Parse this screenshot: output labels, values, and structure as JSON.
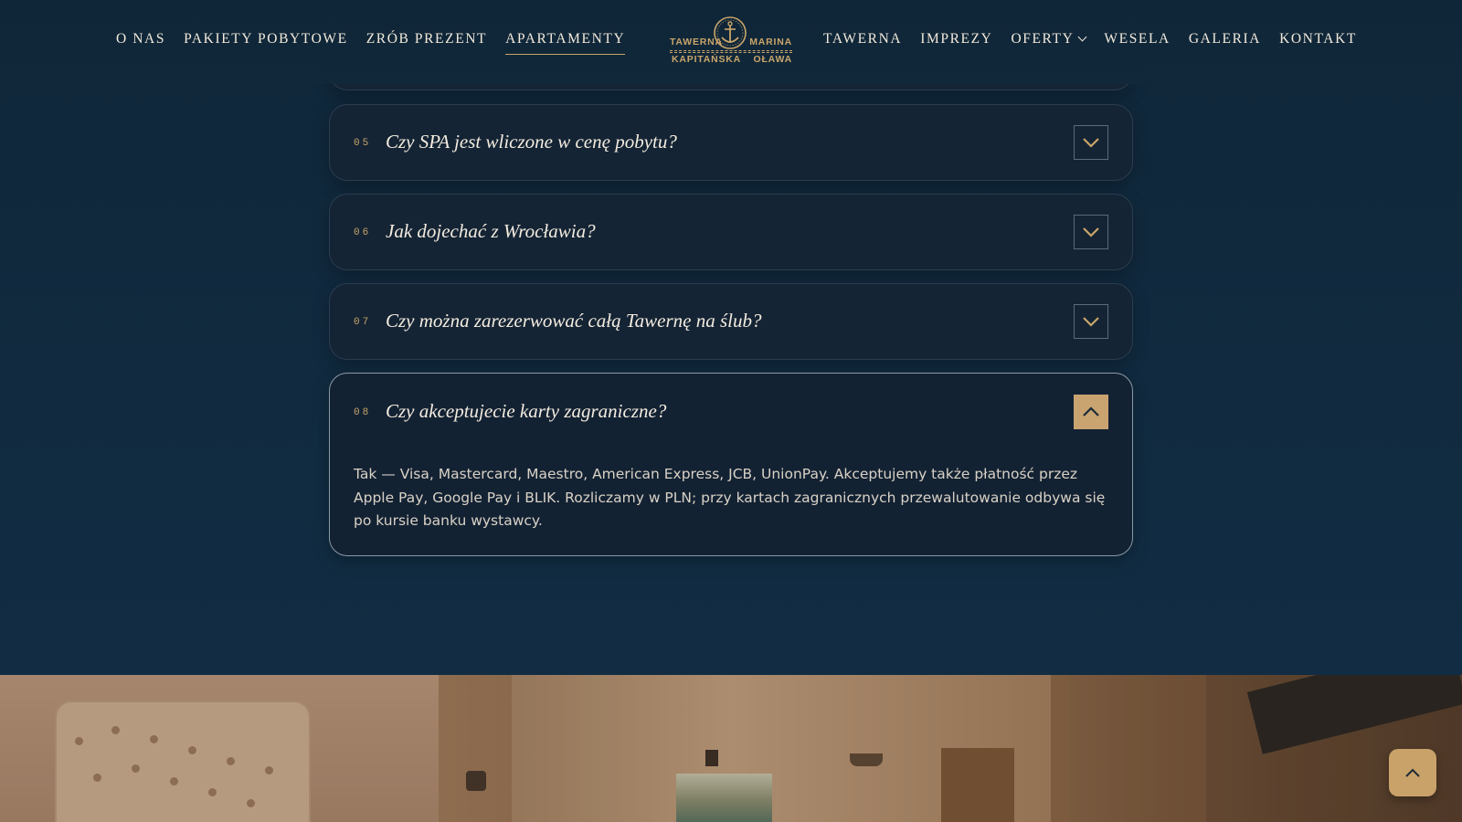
{
  "nav": {
    "left": [
      {
        "label": "O NAS"
      },
      {
        "label": "PAKIETY POBYTOWE"
      },
      {
        "label": "ZRÓB PREZENT"
      },
      {
        "label": "APARTAMENTY",
        "active": true
      }
    ],
    "right": [
      {
        "label": "TAWERNA"
      },
      {
        "label": "IMPREZY"
      },
      {
        "label": "OFERTY",
        "dropdown": true
      },
      {
        "label": "WESELA"
      },
      {
        "label": "GALERIA"
      },
      {
        "label": "KONTAKT"
      }
    ]
  },
  "logo": {
    "line1_left": "TAWERNA",
    "line1_right": "MARINA",
    "line2_left": "KAPITAŃSKA",
    "line2_right": "OŁAWA",
    "icon": "anchor-icon"
  },
  "faq": {
    "items": [
      {
        "num": "05",
        "question": "Czy SPA jest wliczone w cenę pobytu?",
        "open": false
      },
      {
        "num": "06",
        "question": "Jak dojechać z Wrocławia?",
        "open": false
      },
      {
        "num": "07",
        "question": "Czy można zarezerwować całą Tawernę na ślub?",
        "open": false
      },
      {
        "num": "08",
        "question": "Czy akceptujecie karty zagraniczne?",
        "open": true,
        "answer": "Tak — Visa, Mastercard, Maestro, American Express, JCB, UnionPay. Akceptujemy także płatność przez Apple Pay, Google Pay i BLIK. Rozliczamy w PLN; przy kartach zagranicznych przewalutowanie odbywa się po kursie banku wystawcy."
      }
    ]
  },
  "colors": {
    "background": "#10293d",
    "accent_gold": "#c9a56a",
    "card": "#142434",
    "text_light": "#f4ece0"
  },
  "icons": {
    "toggle_closed": "chevron-down-icon",
    "toggle_open": "chevron-up-icon",
    "back_to_top": "chevron-up-icon"
  }
}
